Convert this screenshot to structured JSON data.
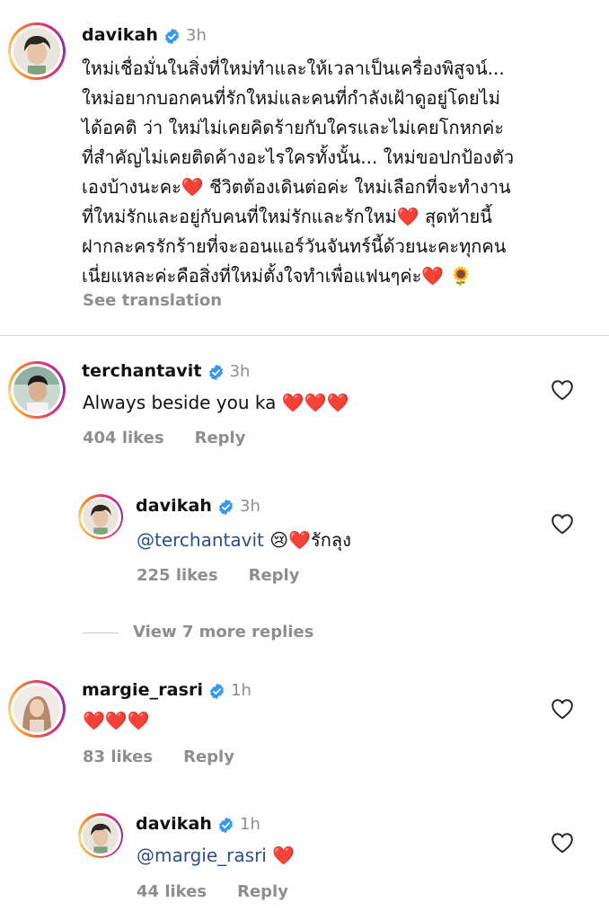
{
  "post": {
    "username": "davikah",
    "time": "3h",
    "caption_lines": [
      "ใหม่เชื่อมั่นในสิ่งที่ใหม่ทำและให้เวลาเป็นเครื่องพิสูจน์...",
      "ใหม่อยากบอกคนที่รักใหม่และคนที่กำลังเฝ้าดูอยู่โดยไม่",
      "ได้อคติ ว่า ใหม่ไม่เคยคิดร้ายกับใครและไม่เคยโกหกค่ะ",
      "ที่สำคัญไม่เคยติดค้างอะไรใครทั้งนั้น... ใหม่ขอปกป้องตัว",
      "เองบ้างนะคะ❤️ ชีวิตต้องเดินต่อค่ะ ใหม่เลือกที่จะทำงาน",
      "ที่ใหม่รักและอยู่กับคนที่ใหม่รักและรักใหม่❤️ สุดท้ายนี้",
      "ฝากละครรักร้ายที่จะออนแอร์วันจันทร์นี้ด้วยนะคะทุกคน",
      "เนี่ยแหละค่ะคือสิ่งที่ใหม่ตั้งใจทำเพื่อแฟนๆค่ะ❤️ 🌻"
    ],
    "see_translation": "See translation"
  },
  "comments": [
    {
      "username": "terchantavit",
      "time": "3h",
      "text": "Always beside you ka ❤️❤️❤️",
      "likes": "404 likes",
      "reply": "Reply"
    },
    {
      "username": "davikah",
      "time": "3h",
      "mention": "@terchantavit",
      "text": " 😢❤️รักลุง",
      "likes": "225 likes",
      "reply": "Reply"
    },
    {
      "view_more": "View 7 more replies"
    },
    {
      "username": "margie_rasri",
      "time": "1h",
      "text": "❤️❤️❤️",
      "likes": "83 likes",
      "reply": "Reply"
    },
    {
      "username": "davikah",
      "time": "1h",
      "mention": "@margie_rasri",
      "text": " ❤️",
      "likes": "44 likes",
      "reply": "Reply"
    }
  ],
  "colors": {
    "verified": "#3897f0",
    "muted": "#8e8e8e",
    "mention": "#2b4f8c",
    "heart": "#ed1c24"
  }
}
